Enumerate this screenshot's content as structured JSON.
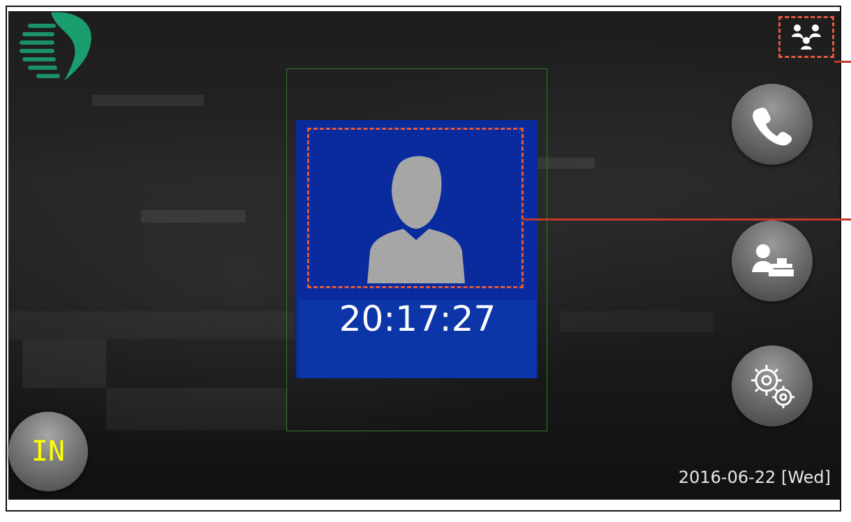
{
  "clock": {
    "time": "20:17:27"
  },
  "status": {
    "mode_label": "IN",
    "date_label": "2016-06-22 [Wed]"
  },
  "buttons": {
    "call": "phone-icon",
    "attendance": "user-desk-icon",
    "settings": "gears-icon",
    "group": "group-network-icon"
  },
  "colors": {
    "card": "#0a2b9e",
    "highlight": "#e05a3e",
    "mode_text": "#ffff00",
    "guide": "#2f7a2f",
    "logo": "#1a9e6e"
  }
}
